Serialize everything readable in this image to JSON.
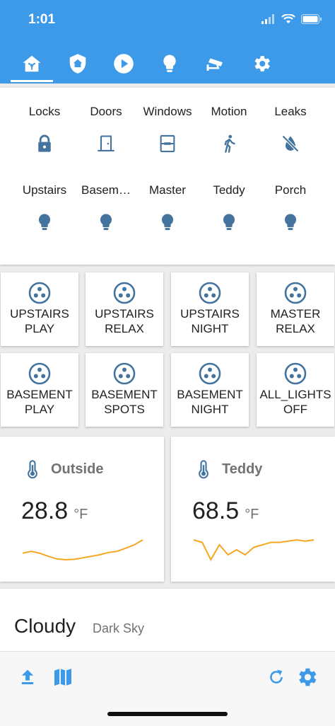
{
  "status_bar": {
    "time": "1:01"
  },
  "tabs": [
    {
      "icon": "home-automation-icon",
      "active": true
    },
    {
      "icon": "shield-home-icon",
      "active": false
    },
    {
      "icon": "play-circle-icon",
      "active": false
    },
    {
      "icon": "lightbulb-icon",
      "active": false
    },
    {
      "icon": "cctv-camera-icon",
      "active": false
    },
    {
      "icon": "gear-icon",
      "active": false
    }
  ],
  "entities": {
    "row1": [
      {
        "label": "Locks",
        "icon": "lock-icon"
      },
      {
        "label": "Doors",
        "icon": "door-icon"
      },
      {
        "label": "Windows",
        "icon": "window-icon"
      },
      {
        "label": "Motion",
        "icon": "walk-icon"
      },
      {
        "label": "Leaks",
        "icon": "water-off-icon"
      }
    ],
    "row2": [
      {
        "label": "Upstairs",
        "icon": "lightbulb-icon"
      },
      {
        "label": "Basem…",
        "icon": "lightbulb-icon"
      },
      {
        "label": "Master",
        "icon": "lightbulb-icon"
      },
      {
        "label": "Teddy",
        "icon": "lightbulb-icon"
      },
      {
        "label": "Porch",
        "icon": "lightbulb-icon"
      }
    ]
  },
  "scenes": [
    {
      "line1": "UPSTAIRS",
      "line2": "PLAY"
    },
    {
      "line1": "UPSTAIRS",
      "line2": "RELAX"
    },
    {
      "line1": "UPSTAIRS",
      "line2": "NIGHT"
    },
    {
      "line1": "MASTER",
      "line2": "RELAX"
    },
    {
      "line1": "BASEMENT",
      "line2": "PLAY"
    },
    {
      "line1": "BASEMENT",
      "line2": "SPOTS"
    },
    {
      "line1": "BASEMENT",
      "line2": "NIGHT"
    },
    {
      "line1": "ALL_LIGHTS",
      "line2": "OFF"
    }
  ],
  "sensors": [
    {
      "name": "Outside",
      "value": "28.8",
      "unit": "°F",
      "history": [
        31,
        31.5,
        31,
        30.2,
        29.5,
        29.3,
        29.4,
        29.8,
        30.2,
        30.6,
        31.2,
        31.5,
        32.3,
        33.2,
        34.5
      ]
    },
    {
      "name": "Teddy",
      "value": "68.5",
      "unit": "°F",
      "history": [
        68.9,
        68.8,
        68.1,
        68.7,
        68.3,
        68.5,
        68.3,
        68.6,
        68.7,
        68.8,
        68.8,
        68.85,
        68.9,
        68.85,
        68.9
      ]
    }
  ],
  "weather": {
    "condition": "Cloudy",
    "source": "Dark Sky"
  },
  "colors": {
    "accent": "#3d9ae8",
    "icon": "#44739e",
    "spark": "#f5a623"
  },
  "bottom_bar": {
    "left": [
      "upload-icon",
      "map-icon"
    ],
    "right": [
      "refresh-icon",
      "gear-icon"
    ]
  }
}
